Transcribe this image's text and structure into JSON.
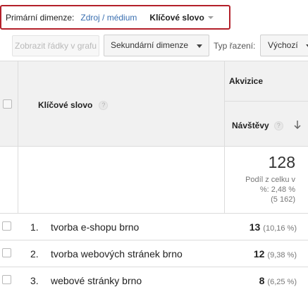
{
  "primary_dimension": {
    "label": "Primární dimenze:",
    "link_source_medium": "Zdroj / médium",
    "active_keyword": "Klíčové slovo"
  },
  "toolbar": {
    "plot_rows_label": "Zobrazit řádky v grafu",
    "secondary_dimension_label": "Sekundární dimenze",
    "sort_type_label": "Typ řazení:",
    "sort_default_label": "Výchozí"
  },
  "table": {
    "header": {
      "keyword_column": "Klíčové slovo",
      "acquisition_group": "Akvizice",
      "visits_column": "Návštěvy"
    },
    "summary": {
      "total": "128",
      "share_line1": "Podíl z celku v",
      "share_line2": "%: 2,48 %",
      "share_line3": "(5 162)"
    },
    "rows": [
      {
        "index": "1.",
        "keyword": "tvorba e-shopu brno",
        "visits": "13",
        "share": "(10,16 %)"
      },
      {
        "index": "2.",
        "keyword": "tvorba webových stránek brno",
        "visits": "12",
        "share": "(9,38 %)"
      },
      {
        "index": "3.",
        "keyword": "webové stránky brno",
        "visits": "8",
        "share": "(6,25 %)"
      }
    ]
  },
  "icons": {
    "help": "question-mark-icon",
    "sort": "arrow-down-icon",
    "dropdown": "caret-down-icon"
  },
  "colors": {
    "highlight_border": "#b3202a",
    "link": "#3a6fb0",
    "header_bg": "#f1f1f1"
  }
}
